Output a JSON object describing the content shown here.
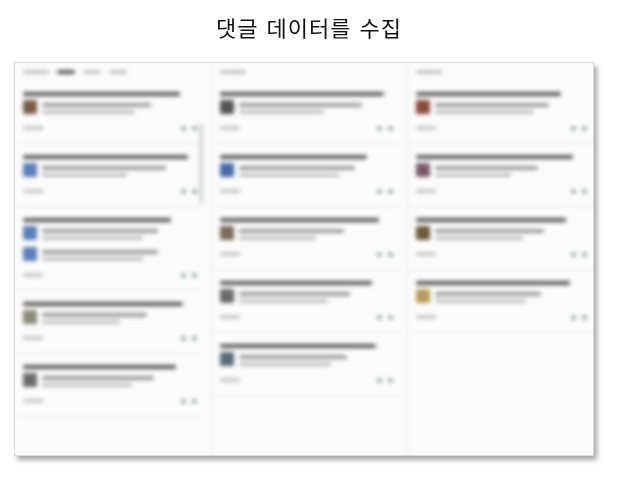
{
  "title": "댓글 데이터를 수집",
  "screenshot": {
    "blurred": true,
    "columns": [
      {
        "id": "col-1",
        "tabs": [
          "",
          "",
          "",
          ""
        ],
        "posts": [
          {
            "avatar_color": "#7a5a4a",
            "comments": 1
          },
          {
            "avatar_color": "#5b7fb6",
            "comments": 1
          },
          {
            "avatar_color": "#5b7fb6",
            "comments": 2
          },
          {
            "avatar_color": "#8a8a7a",
            "comments": 1
          },
          {
            "avatar_color": "#6a6a6a",
            "comments": 1
          }
        ]
      },
      {
        "id": "col-2",
        "tabs": [
          ""
        ],
        "posts": [
          {
            "avatar_color": "#555555",
            "comments": 1
          },
          {
            "avatar_color": "#4a6aa8",
            "comments": 1
          },
          {
            "avatar_color": "#7a6a5a",
            "comments": 1
          },
          {
            "avatar_color": "#6a6a6a",
            "comments": 1
          },
          {
            "avatar_color": "#5a6a7a",
            "comments": 1
          }
        ]
      },
      {
        "id": "col-3",
        "tabs": [
          ""
        ],
        "posts": [
          {
            "avatar_color": "#8a4a3a",
            "comments": 1
          },
          {
            "avatar_color": "#7a5a6a",
            "comments": 1
          },
          {
            "avatar_color": "#6a5a3a",
            "comments": 1
          },
          {
            "avatar_color": "#b89a5a",
            "comments": 1
          }
        ]
      }
    ]
  }
}
